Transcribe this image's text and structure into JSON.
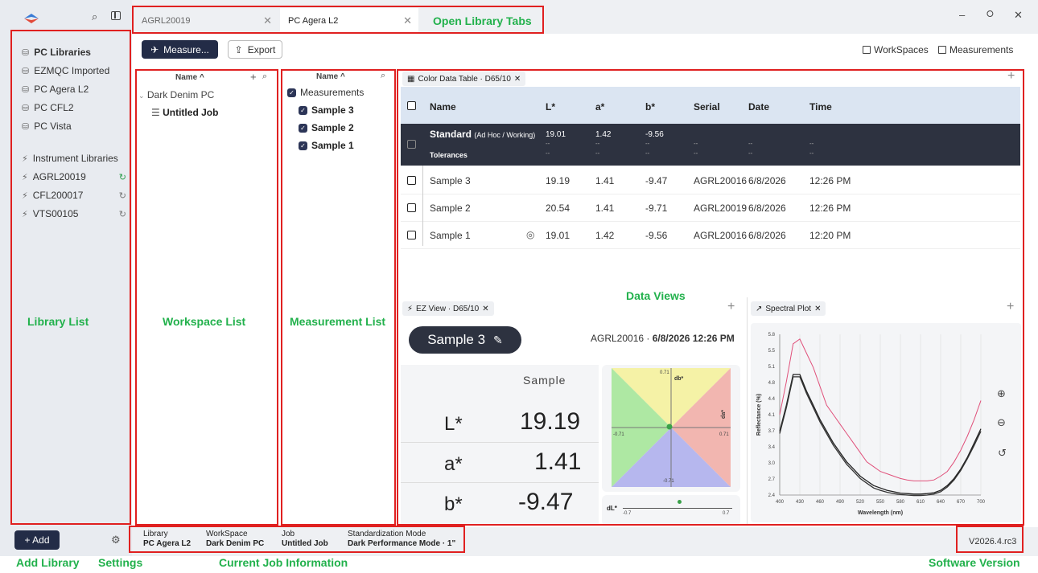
{
  "sidebar": {
    "libraries_header": "PC Libraries",
    "libraries": [
      "EZMQC Imported",
      "PC Agera L2",
      "PC CFL2",
      "PC Vista"
    ],
    "instr_header": "Instrument Libraries",
    "instruments": [
      "AGRL20019",
      "CFL200017",
      "VTS00105"
    ],
    "add_label": "+ Add"
  },
  "tabs": [
    {
      "label": "AGRL20019"
    },
    {
      "label": "PC Agera L2"
    }
  ],
  "toolbar": {
    "measure_label": "Measure...",
    "export_label": "Export",
    "workspaces_label": "WorkSpaces",
    "measurements_label": "Measurements"
  },
  "workspace": {
    "header": "Name ^",
    "group": "Dark Denim PC",
    "job": "Untitled Job"
  },
  "measurements": {
    "header": "Name ^",
    "group": "Measurements",
    "items": [
      "Sample 3",
      "Sample 2",
      "Sample 1"
    ]
  },
  "table": {
    "tab_label": "Color Data Table · D65/10",
    "columns": [
      "Name",
      "L*",
      "a*",
      "b*",
      "Serial",
      "Date",
      "Time"
    ],
    "standard": {
      "name": "Standard",
      "tag": "(Ad Hoc / Working)",
      "L": "19.01",
      "a": "1.42",
      "b": "-9.56"
    },
    "tolerances": {
      "name": "Tolerances",
      "dash": "--"
    },
    "rows": [
      {
        "name": "Sample 3",
        "L": "19.19",
        "a": "1.41",
        "b": "-9.47",
        "serial": "AGRL20016",
        "date": "6/8/2026",
        "time": "12:26 PM"
      },
      {
        "name": "Sample 2",
        "L": "20.54",
        "a": "1.41",
        "b": "-9.71",
        "serial": "AGRL20019",
        "date": "6/8/2026",
        "time": "12:26 PM"
      },
      {
        "name": "Sample 1",
        "L": "19.01",
        "a": "1.42",
        "b": "-9.56",
        "serial": "AGRL20016",
        "date": "6/8/2026",
        "time": "12:20 PM"
      }
    ]
  },
  "ez": {
    "tab_label": "EZ View · D65/10",
    "sample_name": "Sample 3",
    "serial_prefix": "AGRL20016 · ",
    "datetime": "6/8/2026 12:26 PM",
    "col_label": "Sample",
    "L_label": "L*",
    "L": "19.19",
    "a_label": "a*",
    "a": "1.41",
    "b_label": "b*",
    "b": "-9.47",
    "db_label": "db*",
    "da_label": "da*",
    "top": "0.71",
    "bottom": "-0.71",
    "left": "-0.71",
    "right": "0.71",
    "dl_label": "dL*",
    "dl_min": "-0.7",
    "dl_max": "0.7"
  },
  "spectral": {
    "tab_label": "Spectral Plot",
    "ylabel": "Reflectance (%)",
    "xlabel": "Wavelength (nm)",
    "yticks": [
      "5.8",
      "5.5",
      "5.1",
      "4.8",
      "4.4",
      "4.1",
      "3.7",
      "3.4",
      "3.0",
      "2.7",
      "2.4"
    ],
    "xticks": [
      "400",
      "430",
      "460",
      "490",
      "520",
      "550",
      "580",
      "610",
      "640",
      "670",
      "700"
    ]
  },
  "footer": {
    "library_label": "Library",
    "library": "PC Agera L2",
    "workspace_label": "WorkSpace",
    "workspace": "Dark Denim PC",
    "job_label": "Job",
    "job": "Untitled Job",
    "std_label": "Standardization Mode",
    "std": "Dark Performance Mode · 1\"",
    "version": "V2026.4.rc3"
  },
  "annotations": {
    "tabs": "Open Library Tabs",
    "data_views": "Data Views",
    "library_list": "Library List",
    "workspace_list": "Workspace List",
    "measurement_list": "Measurement List",
    "add_library": "Add Library",
    "settings": "Settings",
    "current_job": "Current Job Information",
    "software_version": "Software Version"
  },
  "chart_data": {
    "type": "line",
    "x": [
      400,
      410,
      420,
      430,
      440,
      450,
      460,
      470,
      480,
      490,
      500,
      510,
      520,
      530,
      540,
      550,
      560,
      570,
      580,
      590,
      600,
      610,
      620,
      630,
      640,
      650,
      660,
      670,
      680,
      690,
      700
    ],
    "series": [
      {
        "values": [
          4.1,
          4.8,
          5.6,
          5.7,
          5.4,
          5.1,
          4.7,
          4.3,
          4.1,
          3.9,
          3.7,
          3.5,
          3.3,
          3.1,
          3.0,
          2.9,
          2.85,
          2.8,
          2.75,
          2.72,
          2.7,
          2.7,
          2.7,
          2.72,
          2.8,
          2.9,
          3.1,
          3.35,
          3.65,
          4.0,
          4.4
        ],
        "color": "#e0507a"
      },
      {
        "values": [
          3.75,
          4.3,
          4.95,
          4.95,
          4.6,
          4.3,
          4.0,
          3.75,
          3.5,
          3.3,
          3.1,
          2.95,
          2.8,
          2.7,
          2.6,
          2.55,
          2.5,
          2.47,
          2.44,
          2.43,
          2.42,
          2.42,
          2.43,
          2.45,
          2.5,
          2.6,
          2.75,
          2.95,
          3.2,
          3.5,
          3.8
        ],
        "color": "#222"
      },
      {
        "values": [
          3.7,
          4.25,
          4.9,
          4.9,
          4.55,
          4.25,
          3.95,
          3.7,
          3.45,
          3.25,
          3.05,
          2.9,
          2.75,
          2.65,
          2.55,
          2.5,
          2.46,
          2.43,
          2.41,
          2.4,
          2.39,
          2.39,
          2.4,
          2.42,
          2.47,
          2.57,
          2.72,
          2.92,
          3.17,
          3.45,
          3.75
        ],
        "color": "#333"
      }
    ],
    "ylim": [
      2.4,
      5.8
    ],
    "xlim": [
      400,
      700
    ]
  }
}
